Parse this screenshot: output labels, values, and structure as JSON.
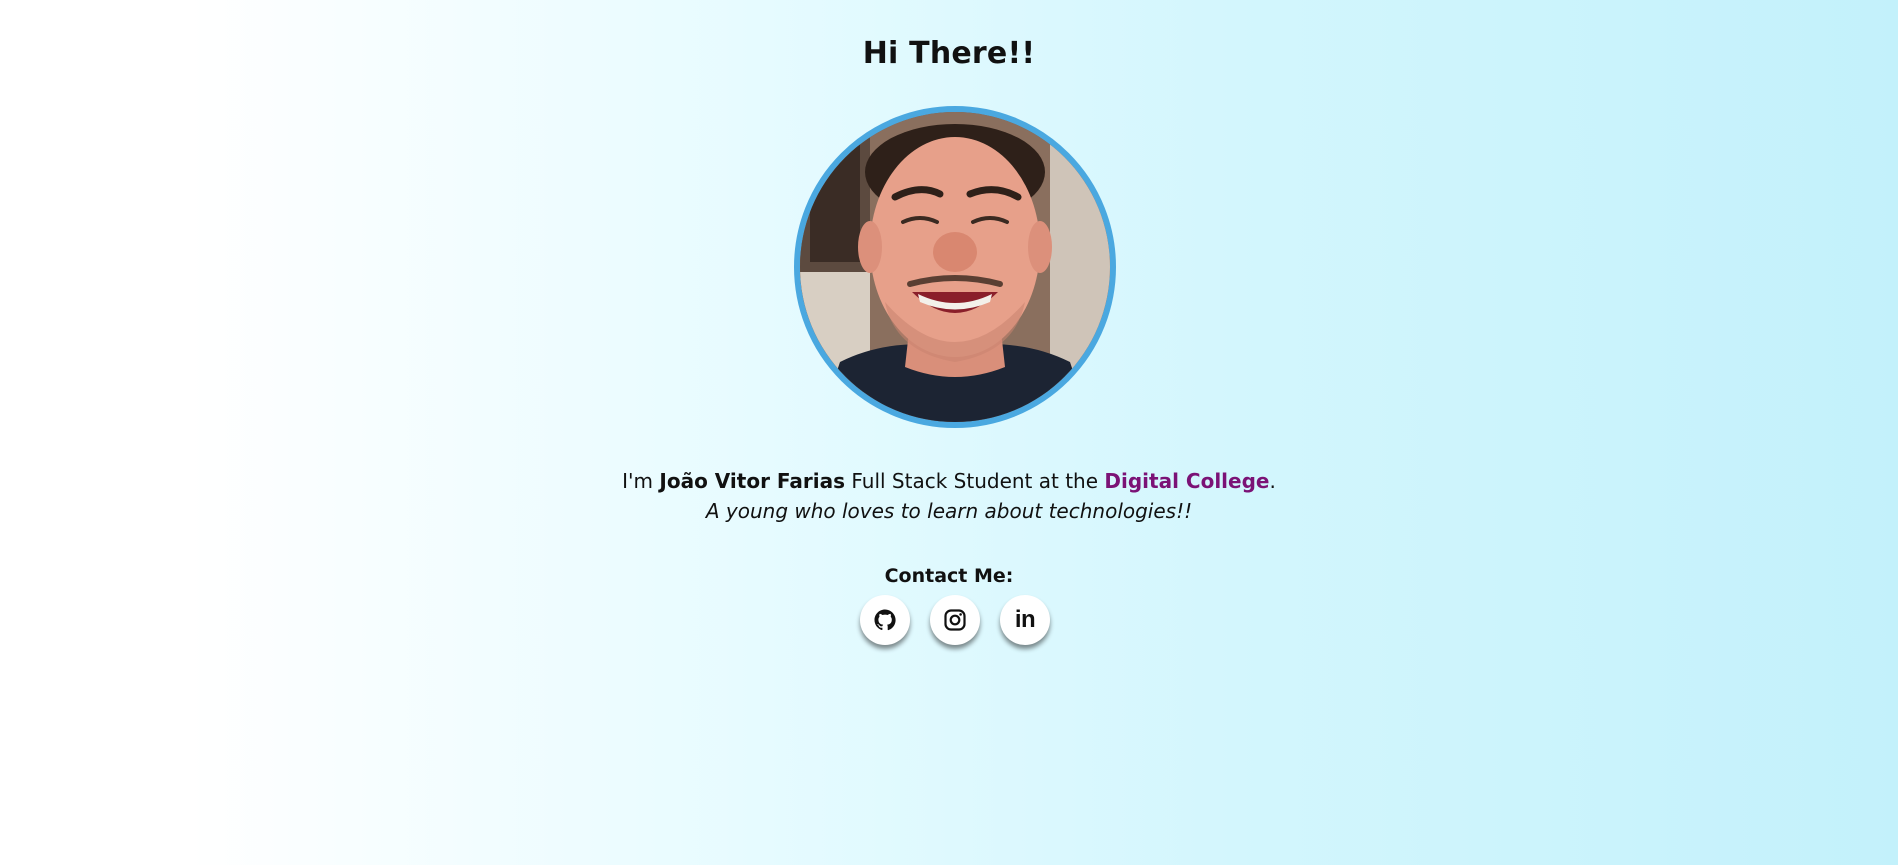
{
  "header": {
    "title": "Hi There!!"
  },
  "profile": {
    "photo_alt": "Profile photo of a smiling young man"
  },
  "intro": {
    "prefix": "I'm ",
    "name": "João Vitor Farias",
    "middle": " Full Stack Student at the ",
    "school": "Digital College",
    "suffix": ".",
    "tagline": "A young who loves to learn about technologies!!"
  },
  "contact": {
    "label": "Contact Me:",
    "links": [
      {
        "icon": "github-icon"
      },
      {
        "icon": "instagram-icon"
      },
      {
        "icon": "linkedin-icon",
        "glyph": "in"
      }
    ]
  },
  "colors": {
    "avatar_border": "#4aa8e0",
    "school_link": "#7b1276",
    "background_start": "#ffffff",
    "background_end": "#c3f1fb"
  }
}
